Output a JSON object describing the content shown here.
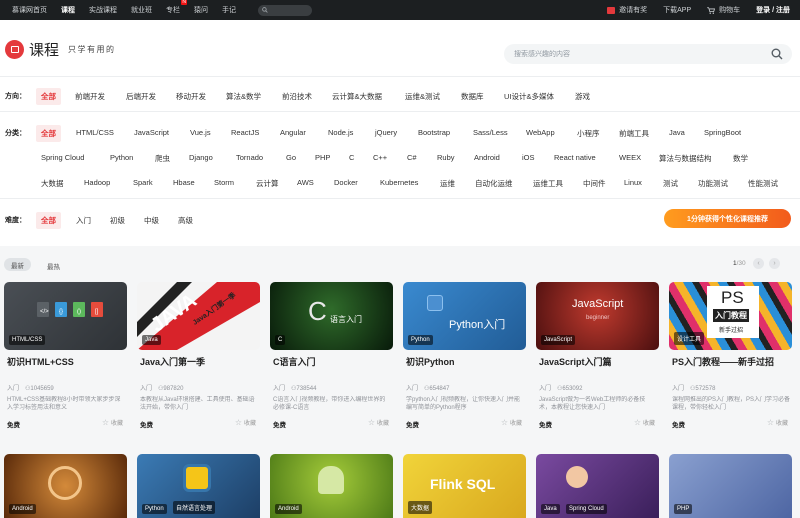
{
  "topnav": {
    "items": [
      "慕课网首页",
      "课程",
      "实战课程",
      "就业班",
      "专栏",
      "猿问",
      "手记"
    ],
    "hot_badge": "N",
    "invite": "邀请有奖",
    "download": "下载APP",
    "cart": "购物车",
    "login": "登录 / 注册"
  },
  "header": {
    "title": "课程",
    "slogan": "只学有用的",
    "search_placeholder": "搜索感兴趣的内容"
  },
  "filters": {
    "direction": {
      "label": "方向：",
      "items": [
        "全部",
        "前端开发",
        "后端开发",
        "移动开发",
        "算法&数学",
        "前沿技术",
        "云计算&大数据",
        "运维&测试",
        "数据库",
        "UI设计&多媒体",
        "游戏"
      ]
    },
    "category": {
      "label": "分类：",
      "rows": [
        [
          "全部",
          "HTML/CSS",
          "JavaScript",
          "Vue.js",
          "ReactJS",
          "Angular",
          "Node.js",
          "jQuery",
          "Bootstrap",
          "Sass/Less",
          "WebApp",
          "小程序",
          "前端工具",
          "Java",
          "SpringBoot"
        ],
        [
          "Spring Cloud",
          "Python",
          "爬虫",
          "Django",
          "Tornado",
          "Go",
          "PHP",
          "C",
          "C++",
          "C#",
          "Ruby",
          "Android",
          "iOS",
          "React native",
          "WEEX",
          "算法与数据结构",
          "数学"
        ],
        [
          "大数据",
          "Hadoop",
          "Spark",
          "Hbase",
          "Storm",
          "云计算",
          "AWS",
          "Docker",
          "Kubernetes",
          "运维",
          "自动化运维",
          "运维工具",
          "中间件",
          "Linux",
          "测试",
          "功能测试",
          "性能测试"
        ]
      ]
    },
    "difficulty": {
      "label": "难度：",
      "items": [
        "全部",
        "入门",
        "初级",
        "中级",
        "高级"
      ]
    },
    "promo": "1分钟获得个性化课程推荐"
  },
  "sort": {
    "latest": "最新",
    "hot": "最热"
  },
  "pager": {
    "current": "1",
    "total": "/30",
    "prev": "‹",
    "next": "›"
  },
  "courses": [
    {
      "badge": "HTML/CSS",
      "title": "初识HTML+CSS",
      "level": "入门",
      "students": "1045659",
      "desc": "HTML+CSS基础教程8小时带领大家步步深入学习标签用法和意义",
      "price": "免费",
      "fav": "收藏",
      "color": "#3b3f44"
    },
    {
      "badge": "Java",
      "title": "Java入门第一季",
      "level": "入门",
      "students": "987820",
      "desc": "本教程从Java环境搭建、工具使用、基础语法开始，带你入门",
      "price": "免费",
      "fav": "收藏",
      "color": "#f2f2f2",
      "art": "JAVA",
      "art_sub": "Java入门第一季"
    },
    {
      "badge": "C",
      "title": "C语言入门",
      "level": "入门",
      "students": "738544",
      "desc": "C语言入门视频教程，带你进入编程世界的必修课-C语言",
      "price": "免费",
      "fav": "收藏",
      "color": "#0f2a12",
      "art": "语言入门"
    },
    {
      "badge": "Python",
      "title": "初识Python",
      "level": "入门",
      "students": "654847",
      "desc": "学python入门视频教程，让你快速入门并能编写简单的Python程序",
      "price": "免费",
      "fav": "收藏",
      "color": "#2e79ba",
      "art": "Python入门"
    },
    {
      "badge": "JavaScript",
      "title": "JavaScript入门篇",
      "level": "入门",
      "students": "653092",
      "desc": "JavaScript做为一名Web工程师的必备技术，本教程让您快速入门",
      "price": "免费",
      "fav": "收藏",
      "color": "#8a1c1c",
      "art": "JavaScript",
      "art_sub": "beginner"
    },
    {
      "badge": "设计工具",
      "title": "PS入门教程——新手过招",
      "level": "入门",
      "students": "572578",
      "desc": "课程网推出的PS入门教程，PS入门学习必备课程，带你轻松入门",
      "price": "免费",
      "fav": "收藏",
      "color": "#e0306a",
      "art": "PS",
      "art_sub": "入门教程",
      "art_sub2": "新手过招"
    }
  ],
  "next_row": [
    {
      "badge": "Android",
      "color": "#a8571d"
    },
    {
      "badge": "Python",
      "badge2": "自然语言处理",
      "color": "#2b5f8c"
    },
    {
      "badge": "Android",
      "color": "#79a82d"
    },
    {
      "badge": "大数据",
      "art": "Flink SQL",
      "color": "#e3c21f"
    },
    {
      "badge": "Java",
      "badge2": "Spring Cloud",
      "color": "#6a3a8c"
    },
    {
      "badge": "PHP",
      "color": "#6d83b8"
    }
  ]
}
